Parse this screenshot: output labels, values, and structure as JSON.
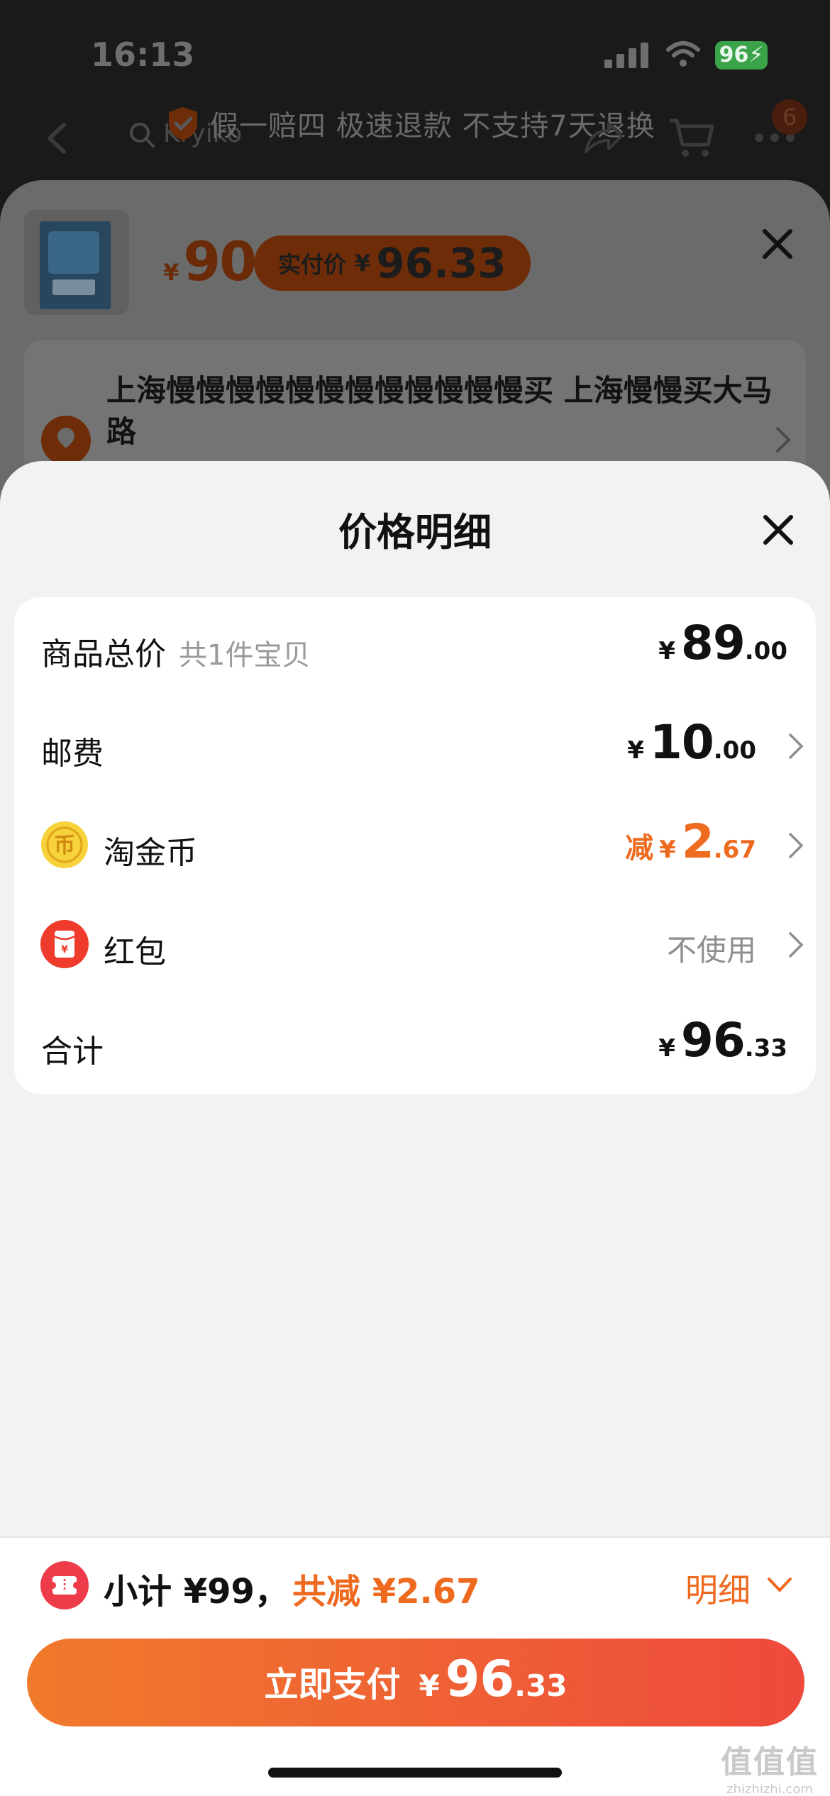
{
  "status_bar": {
    "time": "16:13",
    "battery": "96"
  },
  "nav": {
    "search_text": "Kryiko",
    "guarantee_text": "假一赔四 极速退款 不支持7天退换",
    "cart_badge": "6"
  },
  "sku": {
    "price_yen": "¥",
    "price": "90",
    "real_price_label": "实付价",
    "real_price_yen": "¥",
    "real_price": "96.33",
    "address": "上海慢慢慢慢慢慢慢慢慢慢慢慢买 上海慢慢买大马路"
  },
  "price_detail": {
    "title": "价格明细",
    "rows": [
      {
        "label": "商品总价",
        "sub": "共1件宝贝",
        "yen": "¥",
        "int": "89",
        "dec": ".00"
      },
      {
        "label": "邮费",
        "yen": "¥",
        "int": "10",
        "dec": ".00"
      },
      {
        "label": "淘金币",
        "prefix": "减",
        "yen": "¥",
        "int": "2",
        "dec": ".67",
        "icon": "gold-coin-icon"
      },
      {
        "label": "红包",
        "value": "不使用",
        "icon": "red-packet-icon"
      },
      {
        "label": "合计",
        "yen": "¥",
        "int": "96",
        "dec": ".33"
      }
    ]
  },
  "bottom": {
    "subtotal": "小计 ¥99，",
    "total_save": "共减 ¥2.67",
    "detail_link": "明细",
    "pay_label": "立即支付",
    "pay_yen": "¥",
    "pay_int": "96",
    "pay_dec": ".33"
  },
  "watermark": {
    "main": "值值值",
    "sub": "zhizhizhi.com"
  },
  "colors": {
    "accent": "#ee6a1f",
    "pay_gradient_start": "#f07a2c",
    "pay_gradient_end": "#ee4a3c",
    "sheet_bg": "#f2f2f2"
  }
}
